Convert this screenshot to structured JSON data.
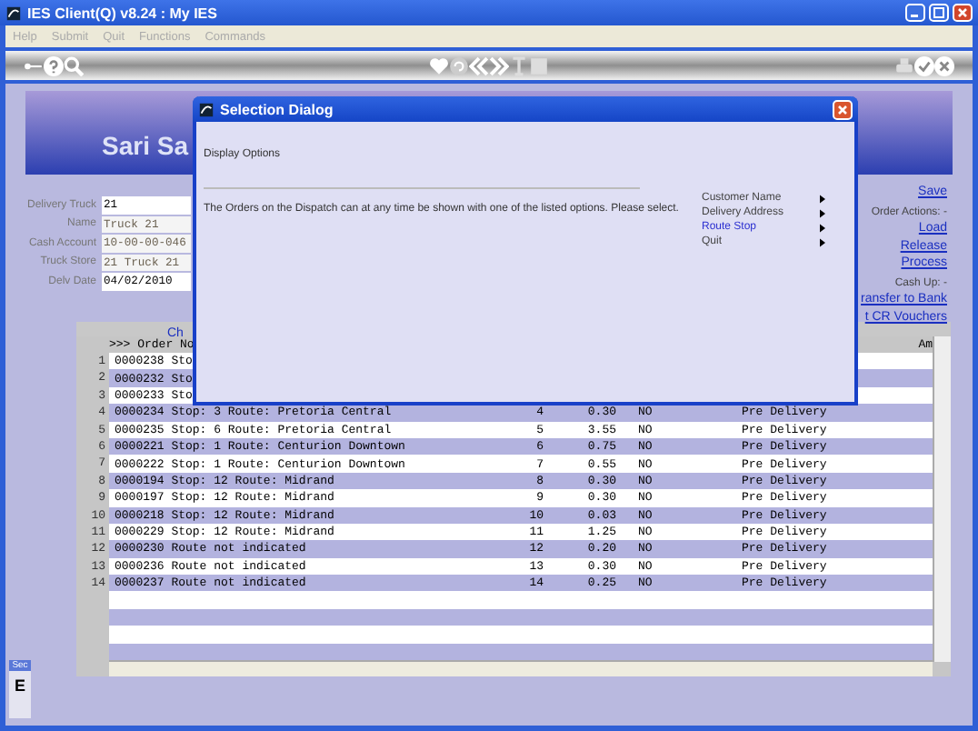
{
  "window": {
    "title": "IES Client(Q) v8.24 : My IES"
  },
  "menu": [
    "Help",
    "Submit",
    "Quit",
    "Functions",
    "Commands"
  ],
  "banner": {
    "title": "Sari Sa"
  },
  "form": [
    {
      "label": "Delivery Truck",
      "value": "21",
      "editable": true
    },
    {
      "label": "Name",
      "value": "Truck 21",
      "editable": false
    },
    {
      "label": "Cash Account",
      "value": "10-00-00-046",
      "editable": false
    },
    {
      "label": "Truck Store",
      "value": "21 Truck 21",
      "editable": false
    },
    {
      "label": "Delv Date",
      "value": "04/02/2010",
      "editable": true
    }
  ],
  "actions": [
    {
      "kind": "link",
      "text": "Save"
    },
    {
      "kind": "label",
      "text": "Order Actions: -"
    },
    {
      "kind": "link",
      "text": "Load"
    },
    {
      "kind": "link",
      "text": "Release"
    },
    {
      "kind": "link",
      "text": "Process"
    },
    {
      "kind": "label",
      "text": "Cash Up: -"
    },
    {
      "kind": "link",
      "text": "ransfer to Bank"
    },
    {
      "kind": "link",
      "text": "t CR Vouchers"
    }
  ],
  "table": {
    "link": "Ch",
    "columns": [
      ">>> Order No",
      "Am"
    ],
    "rows": [
      {
        "num": "1",
        "order": "0000238 Sto"
      },
      {
        "num": "2",
        "order": "0000232 Sto"
      },
      {
        "num": "3",
        "order": "0000233 Sto"
      },
      {
        "num": "4",
        "order": "0000234 Stop: 3 Route: Pretoria Central",
        "stop": "4",
        "amount": "0.30",
        "flag": "NO",
        "status": "Pre Delivery"
      },
      {
        "num": "5",
        "order": "0000235 Stop: 6 Route: Pretoria Central",
        "stop": "5",
        "amount": "3.55",
        "flag": "NO",
        "status": "Pre Delivery"
      },
      {
        "num": "6",
        "order": "0000221 Stop: 1 Route: Centurion Downtown",
        "stop": "6",
        "amount": "0.75",
        "flag": "NO",
        "status": "Pre Delivery"
      },
      {
        "num": "7",
        "order": "0000222 Stop: 1 Route: Centurion Downtown",
        "stop": "7",
        "amount": "0.55",
        "flag": "NO",
        "status": "Pre Delivery"
      },
      {
        "num": "8",
        "order": "0000194 Stop: 12 Route: Midrand",
        "stop": "8",
        "amount": "0.30",
        "flag": "NO",
        "status": "Pre Delivery"
      },
      {
        "num": "9",
        "order": "0000197 Stop: 12 Route: Midrand",
        "stop": "9",
        "amount": "0.30",
        "flag": "NO",
        "status": "Pre Delivery"
      },
      {
        "num": "10",
        "order": "0000218 Stop: 12 Route: Midrand",
        "stop": "10",
        "amount": "0.03",
        "flag": "NO",
        "status": "Pre Delivery"
      },
      {
        "num": "11",
        "order": "0000229 Stop: 12 Route: Midrand",
        "stop": "11",
        "amount": "1.25",
        "flag": "NO",
        "status": "Pre Delivery"
      },
      {
        "num": "12",
        "order": "0000230 Route not indicated",
        "stop": "12",
        "amount": "0.20",
        "flag": "NO",
        "status": "Pre Delivery"
      },
      {
        "num": "13",
        "order": "0000236 Route not indicated",
        "stop": "13",
        "amount": "0.30",
        "flag": "NO",
        "status": "Pre Delivery"
      },
      {
        "num": "14",
        "order": "0000237 Route not indicated",
        "stop": "14",
        "amount": "0.25",
        "flag": "NO",
        "status": "Pre Delivery"
      }
    ]
  },
  "side_panel": {
    "title": "Sec",
    "letter": "E"
  },
  "dialog": {
    "title": "Selection Dialog",
    "heading": "Display Options",
    "message": "The Orders on the Dispatch can at any time be shown with one of the listed options. Please select.",
    "options": [
      {
        "label": "Customer Name",
        "selected": false
      },
      {
        "label": "Delivery Address",
        "selected": false
      },
      {
        "label": "Route Stop",
        "selected": true
      },
      {
        "label": "Quit",
        "selected": false
      }
    ]
  }
}
